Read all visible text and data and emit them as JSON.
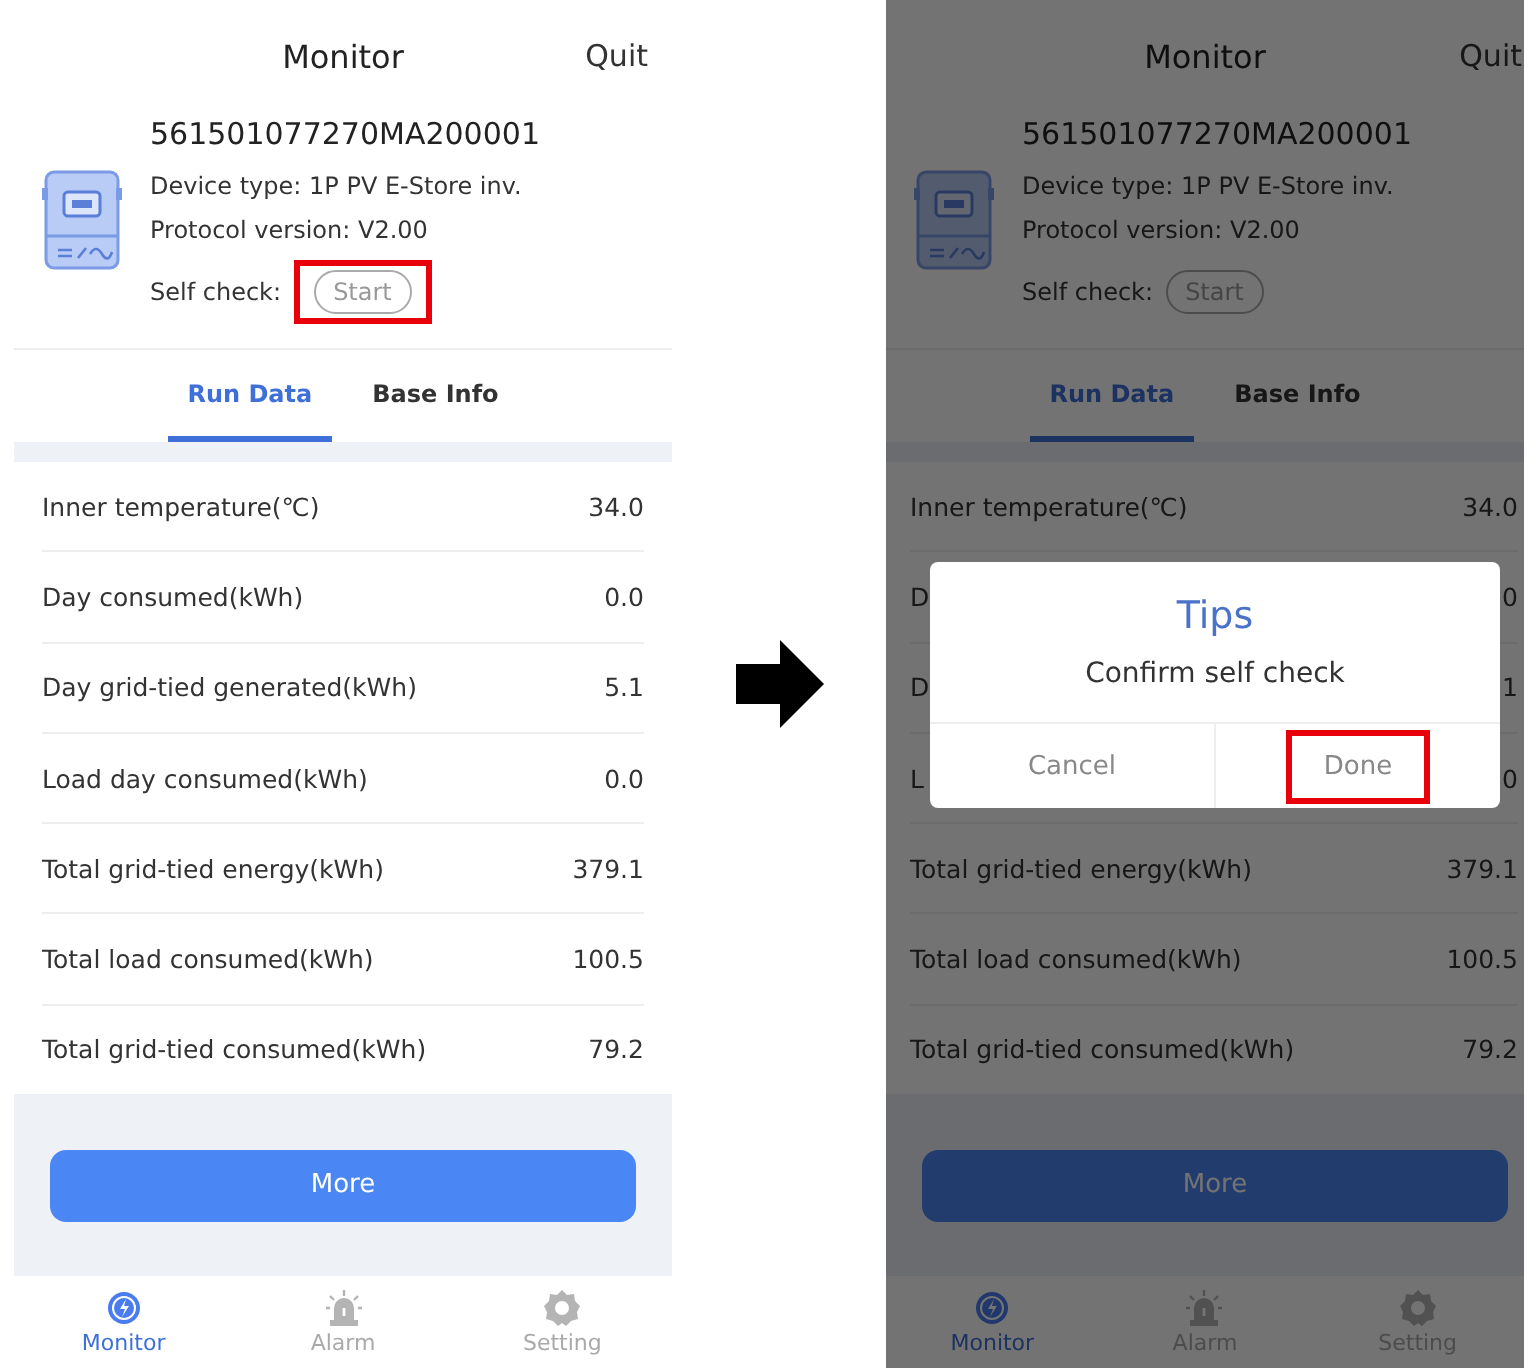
{
  "screens": [
    {
      "dimmed": false,
      "header": {
        "title": "Monitor",
        "action": "Quit"
      },
      "device": {
        "serial": "561501077270MA200001",
        "type_line": "Device type: 1P PV E-Store inv.",
        "protocol_line": "Protocol version: V2.00",
        "self_check_label": "Self check:",
        "self_check_button": {
          "label": "Start",
          "highlighted": true
        }
      },
      "tabs": [
        {
          "label": "Run Data",
          "selected": true
        },
        {
          "label": "Base Info",
          "selected": false
        }
      ],
      "rows": [
        {
          "label": "Inner temperature(℃)",
          "value": "34.0"
        },
        {
          "label": "Day consumed(kWh)",
          "value": "0.0"
        },
        {
          "label": "Day grid-tied generated(kWh)",
          "value": "5.1"
        },
        {
          "label": "Load day consumed(kWh)",
          "value": "0.0"
        },
        {
          "label": "Total grid-tied energy(kWh)",
          "value": "379.1"
        },
        {
          "label": "Total load consumed(kWh)",
          "value": "100.5"
        },
        {
          "label": "Total grid-tied consumed(kWh)",
          "value": "79.2"
        }
      ],
      "more_button": "More",
      "nav": [
        {
          "kind": "monitor",
          "label": "Monitor",
          "selected": true
        },
        {
          "kind": "alarm",
          "label": "Alarm",
          "selected": false
        },
        {
          "kind": "setting",
          "label": "Setting",
          "selected": false
        }
      ]
    },
    {
      "dimmed": true,
      "header": {
        "title": "Monitor",
        "action": "Quit"
      },
      "device": {
        "serial": "561501077270MA200001",
        "type_line": "Device type: 1P PV E-Store inv.",
        "protocol_line": "Protocol version: V2.00",
        "self_check_label": "Self check:",
        "self_check_button": {
          "label": "Start",
          "highlighted": false
        }
      },
      "tabs": [
        {
          "label": "Run Data",
          "selected": true
        },
        {
          "label": "Base Info",
          "selected": false
        }
      ],
      "rows": [
        {
          "label": "Inner temperature(℃)",
          "value": "34.0"
        },
        {
          "label": "D",
          "value": "0"
        },
        {
          "label": "D",
          "value": "1"
        },
        {
          "label": "L",
          "value": "0"
        },
        {
          "label": "Total grid-tied energy(kWh)",
          "value": "379.1"
        },
        {
          "label": "Total load consumed(kWh)",
          "value": "100.5"
        },
        {
          "label": "Total grid-tied consumed(kWh)",
          "value": "79.2"
        }
      ],
      "more_button": "More",
      "nav": [
        {
          "kind": "monitor",
          "label": "Monitor",
          "selected": true
        },
        {
          "kind": "alarm",
          "label": "Alarm",
          "selected": false
        },
        {
          "kind": "setting",
          "label": "Setting",
          "selected": false
        }
      ],
      "dialog": {
        "title": "Tips",
        "message": "Confirm self check",
        "buttons": [
          {
            "label": "Cancel",
            "highlighted": false
          },
          {
            "label": "Done",
            "highlighted": true
          }
        ]
      }
    }
  ]
}
